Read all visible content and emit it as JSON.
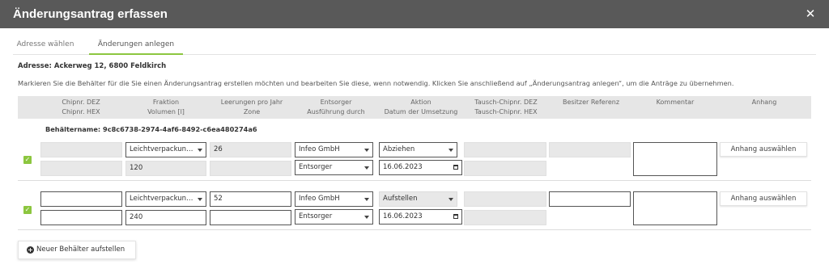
{
  "dialog": {
    "title": "Änderungsantrag erfassen",
    "close_glyph": "✕"
  },
  "tabs": [
    {
      "label": "Adresse wählen",
      "active": false
    },
    {
      "label": "Änderungen anlegen",
      "active": true
    }
  ],
  "address_label": "Adresse: Ackerweg 12, 6800 Feldkirch",
  "instructions": "Markieren Sie die Behälter für die Sie einen Änderungsantrag erstellen möchten und bearbeiten Sie diese, wenn notwendig. Klicken Sie anschließend auf „Änderungsantrag anlegen“, um die Anträge zu übernehmen.",
  "columns": [
    {
      "line1": "Chipnr. DEZ",
      "line2": "Chipnr. HEX"
    },
    {
      "line1": "Fraktion",
      "line2": "Volumen [l]"
    },
    {
      "line1": "Leerungen pro Jahr",
      "line2": "Zone"
    },
    {
      "line1": "Entsorger",
      "line2": "Ausführung durch"
    },
    {
      "line1": "Aktion",
      "line2": "Datum der Umsetzung"
    },
    {
      "line1": "Tausch-Chipnr. DEZ",
      "line2": "Tausch-Chipnr. HEX"
    },
    {
      "line1": "Besitzer Referenz",
      "line2": ""
    },
    {
      "line1": "Kommentar",
      "line2": ""
    },
    {
      "line1": "Anhang",
      "line2": ""
    }
  ],
  "container_name_label": "Behältername: 9c8c6738-2974-4af6-8492-c6ea480274a6",
  "rows": [
    {
      "checked": true,
      "check_glyph": "✓",
      "chip_dez": "",
      "chip_hex": "",
      "fraktion": "Leichtverpackun…",
      "volumen": "120",
      "leerungen": "26",
      "zone": "",
      "entsorger": "Infeo GmbH",
      "ausfuehrung": "Entsorger",
      "aktion": "Abziehen",
      "datum": "16.06.2023",
      "tausch_dez": "",
      "tausch_hex": "",
      "besitzer_referenz": "",
      "kommentar": "",
      "anhang_button": "Anhang auswählen"
    },
    {
      "checked": true,
      "check_glyph": "✓",
      "chip_dez": "",
      "chip_hex": "",
      "fraktion": "Leichtverpackun…",
      "volumen": "240",
      "leerungen": "52",
      "zone": "",
      "entsorger": "Infeo GmbH",
      "ausfuehrung": "Entsorger",
      "aktion": "Aufstellen",
      "datum": "16.06.2023",
      "tausch_dez": "",
      "tausch_hex": "",
      "besitzer_referenz": "",
      "kommentar": "",
      "anhang_button": "Anhang auswählen"
    }
  ],
  "new_container_button": {
    "icon": "plus-circle-icon",
    "glyph": "+",
    "label": "Neuer Behälter aufstellen"
  },
  "colors": {
    "titlebar": "#595959",
    "accent": "#8cc63f",
    "header_bg": "#e6e6e6",
    "readonly_field": "#e8e8e8"
  }
}
